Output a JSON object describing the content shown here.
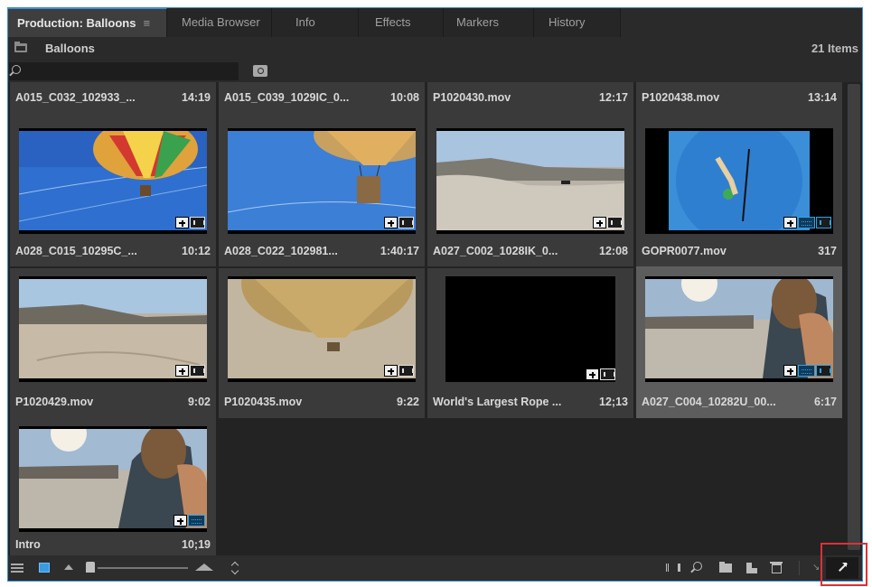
{
  "tabs": [
    {
      "label": "Production: Balloons",
      "active": true
    },
    {
      "label": "Media Browser"
    },
    {
      "label": "Info"
    },
    {
      "label": "Effects"
    },
    {
      "label": "Markers"
    },
    {
      "label": "History"
    }
  ],
  "tab_menu_icon": "≡",
  "header": {
    "bin_title": "Balloons",
    "item_count": "21 Items"
  },
  "search": {
    "placeholder": "",
    "value": ""
  },
  "clips": [
    {
      "name": "A015_C032_102933_...",
      "duration": "14:19"
    },
    {
      "name": "A015_C039_1029IC_0...",
      "duration": "10:08"
    },
    {
      "name": "P1020430.mov",
      "duration": "12:17"
    },
    {
      "name": "P1020438.mov",
      "duration": "13:14"
    },
    {
      "name": "A028_C015_10295C_...",
      "duration": "10:12"
    },
    {
      "name": "A028_C022_102981...",
      "duration": "1:40:17"
    },
    {
      "name": "A027_C002_1028IK_0...",
      "duration": "12:08"
    },
    {
      "name": "GOPR0077.mov",
      "duration": "317"
    },
    {
      "name": "P1020429.mov",
      "duration": "9:02"
    },
    {
      "name": "P1020435.mov",
      "duration": "9:22"
    },
    {
      "name": "World's Largest Rope ...",
      "duration": "12;13"
    },
    {
      "name": "A027_C004_10282U_00...",
      "duration": "6:17",
      "selected": true
    },
    {
      "name": "Intro",
      "duration": "10;19"
    }
  ],
  "colors": {
    "accent": "#3b8fd6",
    "panel_bg": "#232323",
    "highlight": "#e03030"
  },
  "icons": {
    "toolbar_left": [
      "list-view-icon",
      "icon-view-icon",
      "sort-icon",
      "zoom-small-icon",
      "zoom-big-icon",
      "sort-order-icon"
    ],
    "toolbar_right": [
      "automate-to-sequence-icon",
      "find-icon",
      "new-bin-icon",
      "new-item-icon",
      "trash-icon",
      "collapse-icon",
      "expand-icon"
    ]
  }
}
